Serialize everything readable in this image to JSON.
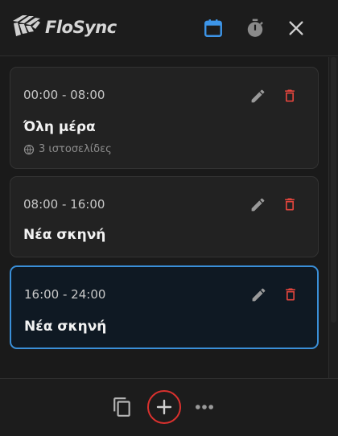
{
  "app": {
    "brand": "FloSync"
  },
  "header": {
    "icons": [
      "calendar-icon",
      "timer-icon",
      "close-icon"
    ],
    "active_color": "#3d95e8"
  },
  "scenes": [
    {
      "time": "00:00 - 08:00",
      "name": "Όλη μέρα",
      "sub": "3 ιστοσελίδες",
      "selected": false
    },
    {
      "time": "08:00 - 16:00",
      "name": "Νέα σκηνή",
      "sub": "",
      "selected": false
    },
    {
      "time": "16:00 - 24:00",
      "name": "Νέα σκηνή",
      "sub": "",
      "selected": true
    }
  ],
  "footer": {
    "icons": [
      "copy-icon",
      "add-icon",
      "more-icon"
    ],
    "highlight_color": "#d9312e"
  },
  "colors": {
    "background": "#1a1a1a",
    "card": "#222222",
    "selected_card": "#0f1923",
    "selected_border": "#3a8fd8",
    "delete": "#e2453d",
    "icon_gray": "#9a9a9a"
  }
}
